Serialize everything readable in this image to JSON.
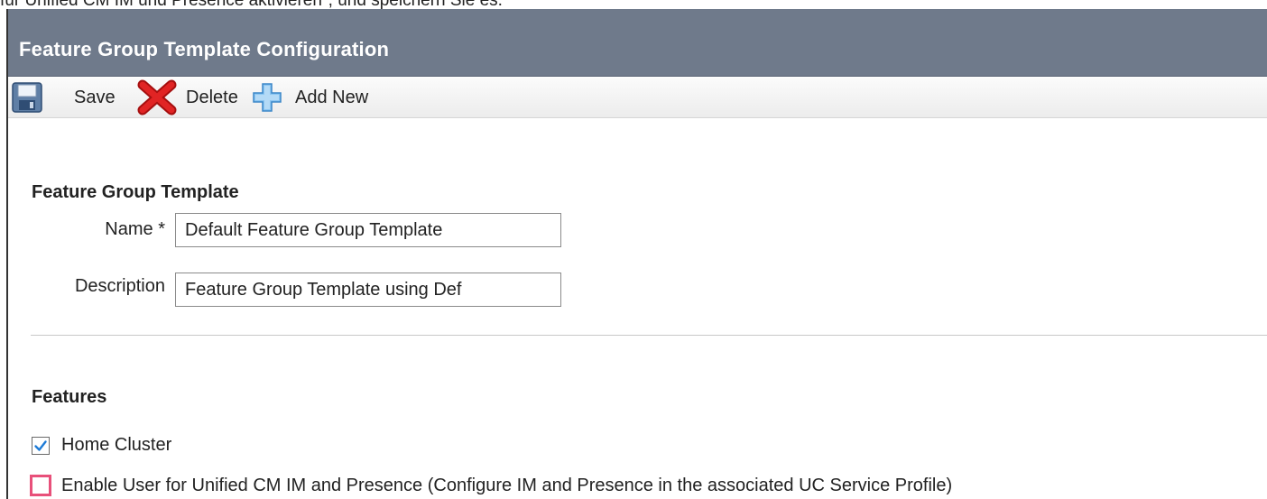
{
  "caption": "für Unified CM IM und Presence aktivieren\", und speichern Sie es.",
  "window": {
    "title": "Feature Group Template Configuration"
  },
  "toolbar": {
    "save_label": "Save",
    "delete_label": "Delete",
    "add_new_label": "Add New"
  },
  "feature_group_template": {
    "section_title": "Feature Group Template",
    "name_label": "Name *",
    "name_value": "Default Feature Group Template",
    "description_label": "Description",
    "description_value": "Feature Group Template using Def"
  },
  "features": {
    "section_title": "Features",
    "items": [
      {
        "label": "Home Cluster",
        "checked": true
      },
      {
        "label": "Enable User for Unified CM IM and Presence (Configure IM and Presence in the associated UC Service Profile)",
        "checked": false
      }
    ]
  },
  "colors": {
    "title_bar": "#6f7a8b",
    "highlight": "#e8507a",
    "check_mark": "#1e7bd6",
    "delete_x": "#cc1a1a",
    "add_plus": "#5aa7e6"
  },
  "icons": {
    "save": "floppy-disk-icon",
    "delete": "red-x-icon",
    "add_new": "blue-plus-icon",
    "checkmark": "checkmark-icon"
  }
}
